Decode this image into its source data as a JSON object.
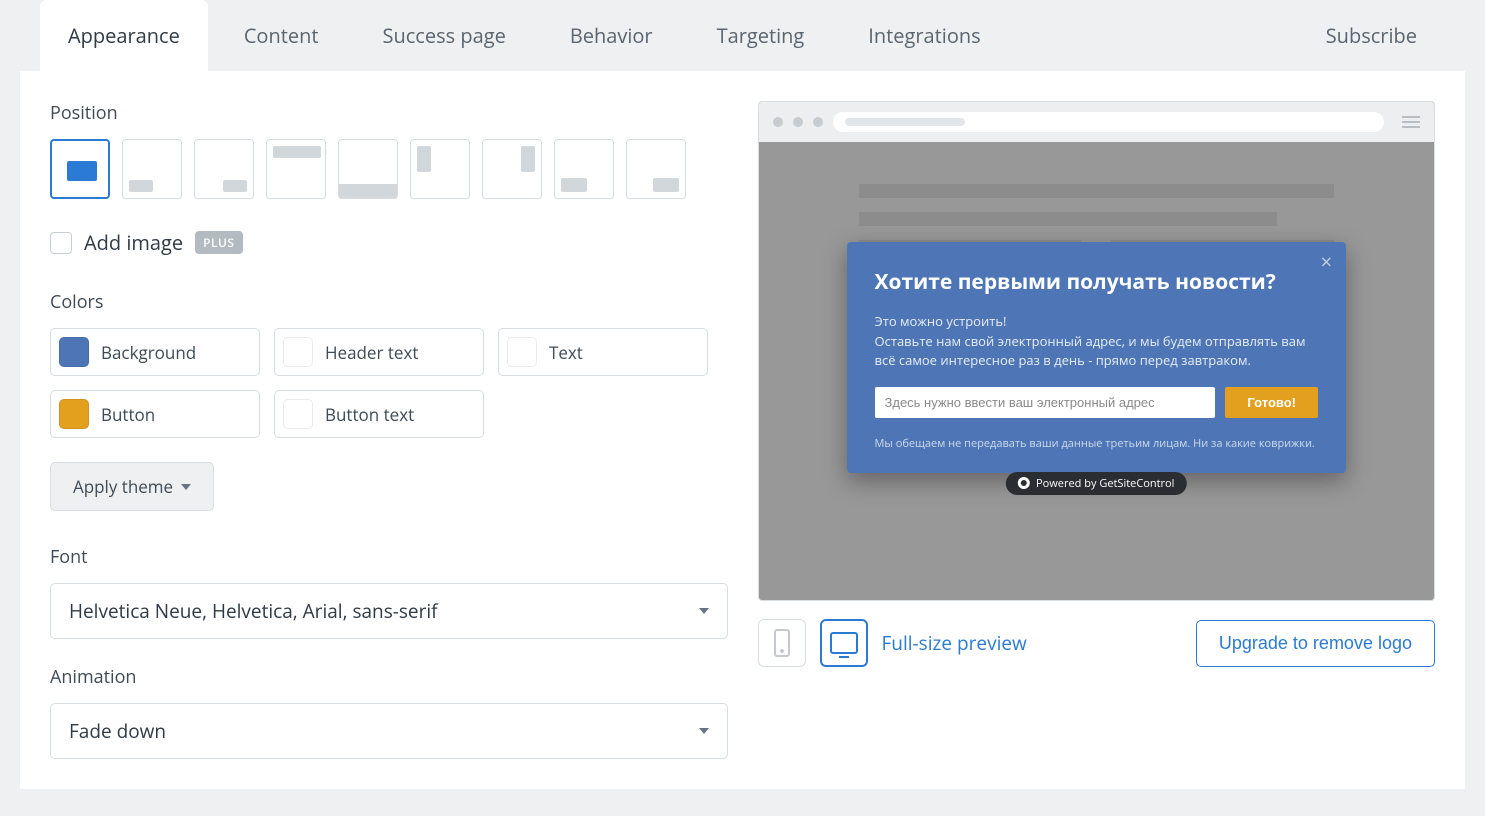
{
  "tabs": {
    "appearance": "Appearance",
    "content": "Content",
    "success": "Success page",
    "behavior": "Behavior",
    "targeting": "Targeting",
    "integrations": "Integrations",
    "subscribe": "Subscribe"
  },
  "sections": {
    "position": "Position",
    "add_image": "Add image",
    "plus": "PLUS",
    "colors": "Colors",
    "font": "Font",
    "animation": "Animation"
  },
  "colors": {
    "background": {
      "label": "Background",
      "hex": "#4e76b6"
    },
    "header_text": {
      "label": "Header text",
      "hex": "#ffffff"
    },
    "text": {
      "label": "Text",
      "hex": "#ffffff"
    },
    "button": {
      "label": "Button",
      "hex": "#e2a01e"
    },
    "button_text": {
      "label": "Button text",
      "hex": "#ffffff"
    }
  },
  "apply_theme": "Apply theme",
  "font_value": "Helvetica Neue, Helvetica, Arial, sans-serif",
  "animation_value": "Fade down",
  "preview": {
    "title": "Хотите первыми получать новости?",
    "line1": "Это можно устроить!",
    "line2": "Оставьте нам свой электронный адрес, и мы будем отправлять вам всё самое интересное раз в день - прямо перед завтраком.",
    "placeholder": "Здесь нужно ввести ваш электронный адрес",
    "button": "Готово!",
    "note": "Мы обещаем не передавать ваши данные третьим лицам. Ни за какие коврижки.",
    "powered": "Powered by GetSiteControl"
  },
  "footer": {
    "fullsize": "Full-size preview",
    "upgrade": "Upgrade to remove logo"
  }
}
